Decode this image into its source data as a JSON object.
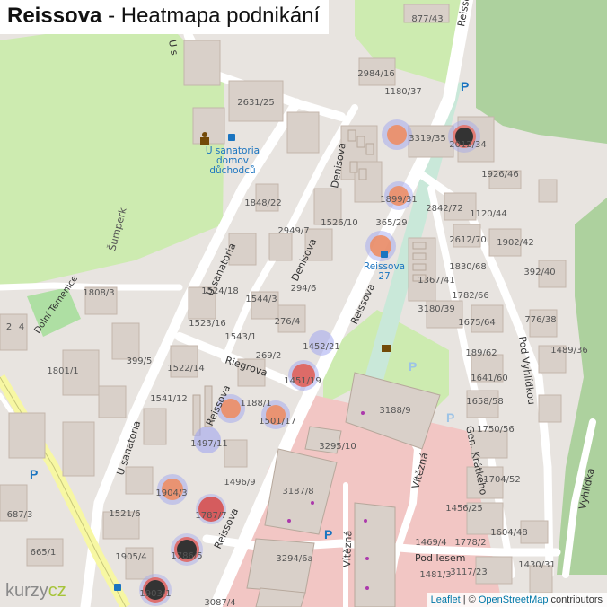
{
  "title": {
    "street": "Reissova",
    "rest": " - Heatmapa podnikání"
  },
  "attribution": {
    "leaflet": "Leaflet",
    "sep": " | © ",
    "osm": "OpenStreetMap",
    "contrib": " contributors"
  },
  "logo": {
    "a": "kurzy",
    "b": "cz"
  },
  "colors": {
    "park": "#cdebb0",
    "road": "#ffffff",
    "building": "#d9d0c9",
    "buildingEdge": "#c4b6ab",
    "pedestrian": "#f2c6c4",
    "railway": "#c9e8d9",
    "blue": "#1a74c0",
    "yellowRoad": "#f7f7a3"
  },
  "streets": [
    {
      "id": "reissova-top",
      "text": "Reissova"
    },
    {
      "id": "reissova-mid",
      "text": "Reissova"
    },
    {
      "id": "reissova-left",
      "text": "Reissova"
    },
    {
      "id": "reissova-bottom",
      "text": "Reissova"
    },
    {
      "id": "denisova-1",
      "text": "Denisova"
    },
    {
      "id": "denisova-2",
      "text": "Denisova"
    },
    {
      "id": "u-sanatoria-1",
      "text": "U sanatoria"
    },
    {
      "id": "u-sanatoria-2",
      "text": "U sanatoria"
    },
    {
      "id": "u-s-top",
      "text": "U s"
    },
    {
      "id": "riegrova",
      "text": "Riegrova"
    },
    {
      "id": "sumperk",
      "text": "Šumperk"
    },
    {
      "id": "dolni-temenice",
      "text": "Dolní Temenice"
    },
    {
      "id": "pod-vyhlidkou",
      "text": "Pod Vyhlídkou"
    },
    {
      "id": "vyhlidka",
      "text": "Vyhlídka"
    },
    {
      "id": "gen-kratkeho",
      "text": "Gen. Krátkého"
    },
    {
      "id": "vitezna-1",
      "text": "Vítězná"
    },
    {
      "id": "vitezna-2",
      "text": "Vítězná"
    },
    {
      "id": "pod-lesem",
      "text": "Pod lesem"
    }
  ],
  "pois": [
    {
      "id": "u-sanatoria-stop",
      "lines": [
        "U sanatoria",
        "domov",
        "důchodců"
      ]
    },
    {
      "id": "reissova-27-stop",
      "lines": [
        "Reissova",
        "27"
      ]
    }
  ],
  "house_numbers": [
    "877/43",
    "2984/16",
    "1180/37",
    "2631/25",
    "3319/35",
    "2012/34",
    "1926/46",
    "1848/22",
    "1899/31",
    "2842/72",
    "1120/44",
    "2949/7",
    "1526/10",
    "365/29",
    "2612/70",
    "1902/42",
    "1830/68",
    "392/40",
    "1808/3",
    "1524/18",
    "1544/3",
    "294/6",
    "1367/41",
    "1782/66",
    "1523/16",
    "276/4",
    "3180/39",
    "1675/64",
    "776/38",
    "2",
    "4",
    "1543/1",
    "1452/21",
    "1489/36",
    "399/5",
    "1801/1",
    "269/2",
    "189/62",
    "1522/14",
    "1641/60",
    "1451/19",
    "1541/12",
    "1188/1",
    "1658/58",
    "3188/9",
    "1501/17",
    "1750/56",
    "1497/11",
    "3295/10",
    "1496/9",
    "1704/52",
    "1904/3",
    "3187/8",
    "1521/6",
    "687/3",
    "1787/7",
    "1456/25",
    "665/1",
    "1905/4",
    "1786/5",
    "3294/6a",
    "1604/48",
    "1469/4",
    "1778/2",
    "1430/31",
    "1481/3",
    "3117/23",
    "3087/4",
    "1903/1"
  ]
}
